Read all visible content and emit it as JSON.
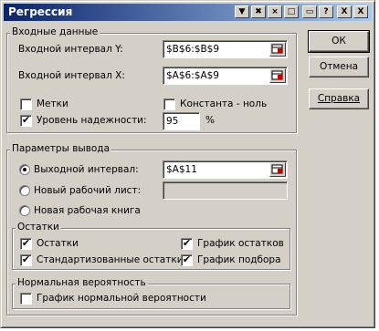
{
  "window": {
    "title": "Регрессия",
    "title_buttons": [
      "▼",
      "✖",
      "×",
      "□",
      "▭",
      "?",
      "X"
    ]
  },
  "input_group": {
    "title": "Входные данные",
    "y_label": "Входной интервал Y:",
    "y_value": "$B$6:$B$9",
    "x_label": "Входной интервал X:",
    "x_value": "$A$6:$A$9",
    "labels_checkbox": "Метки",
    "labels_checked": false,
    "constant_zero_checkbox": "Константа - ноль",
    "constant_zero_checked": false,
    "confidence_checkbox": "Уровень надежности:",
    "confidence_checked": true,
    "confidence_value": "95",
    "percent_sign": "%"
  },
  "output_group": {
    "title": "Параметры вывода",
    "output_range_label": "Выходной интервал:",
    "output_range_value": "$A$11",
    "new_sheet_label": "Новый рабочий лист:",
    "new_sheet_value": "",
    "new_book_label": "Новая рабочая книга",
    "selected": "output_range"
  },
  "residuals_group": {
    "title": "Остатки",
    "residuals": "Остатки",
    "residuals_checked": true,
    "standardized": "Стандартизованные остатки",
    "standardized_checked": true,
    "residual_plot": "График остатков",
    "residual_plot_checked": true,
    "fit_plot": "График подбора",
    "fit_plot_checked": true
  },
  "normal_group": {
    "title": "Нормальная вероятность",
    "normal_plot": "График нормальной вероятности",
    "normal_plot_checked": false
  },
  "buttons": {
    "ok": "ОК",
    "cancel": "Отмена",
    "help": "Справка"
  },
  "icons": {
    "range_picker": "range-select-icon",
    "check_mark": "✔"
  }
}
